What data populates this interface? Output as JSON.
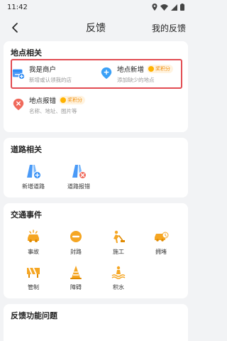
{
  "status_bar": {
    "time": "11:42"
  },
  "header": {
    "title": "反馈",
    "right_link": "我的反馈"
  },
  "location_section": {
    "title": "地点相关",
    "items": [
      {
        "name": "我是商户",
        "desc": "新增或认领我的店",
        "icon": "shop-add-icon"
      },
      {
        "name": "地点新增",
        "desc": "添加缺少的地点",
        "badge": "奖积分",
        "icon": "location-add-icon"
      },
      {
        "name": "地点报错",
        "desc": "名称、地址、图片等",
        "badge": "奖积分",
        "icon": "location-error-icon"
      }
    ]
  },
  "road_section": {
    "title": "道路相关",
    "items": [
      {
        "label": "新增道路",
        "icon": "road-add-icon"
      },
      {
        "label": "道路报错",
        "icon": "road-error-icon"
      }
    ]
  },
  "traffic_section": {
    "title": "交通事件",
    "items": [
      {
        "label": "事故",
        "icon": "accident-icon"
      },
      {
        "label": "封路",
        "icon": "road-closed-icon"
      },
      {
        "label": "施工",
        "icon": "construction-icon"
      },
      {
        "label": "拥堵",
        "icon": "congestion-icon"
      },
      {
        "label": "管制",
        "icon": "control-icon"
      },
      {
        "label": "障碍",
        "icon": "obstacle-icon"
      },
      {
        "label": "积水",
        "icon": "flooding-icon"
      }
    ]
  },
  "func_section": {
    "title": "反馈功能问题"
  },
  "colors": {
    "accent_blue": "#2f8cf5",
    "accent_orange": "#f5a623",
    "error_red": "#e24c52",
    "highlight": "#e24c52"
  }
}
